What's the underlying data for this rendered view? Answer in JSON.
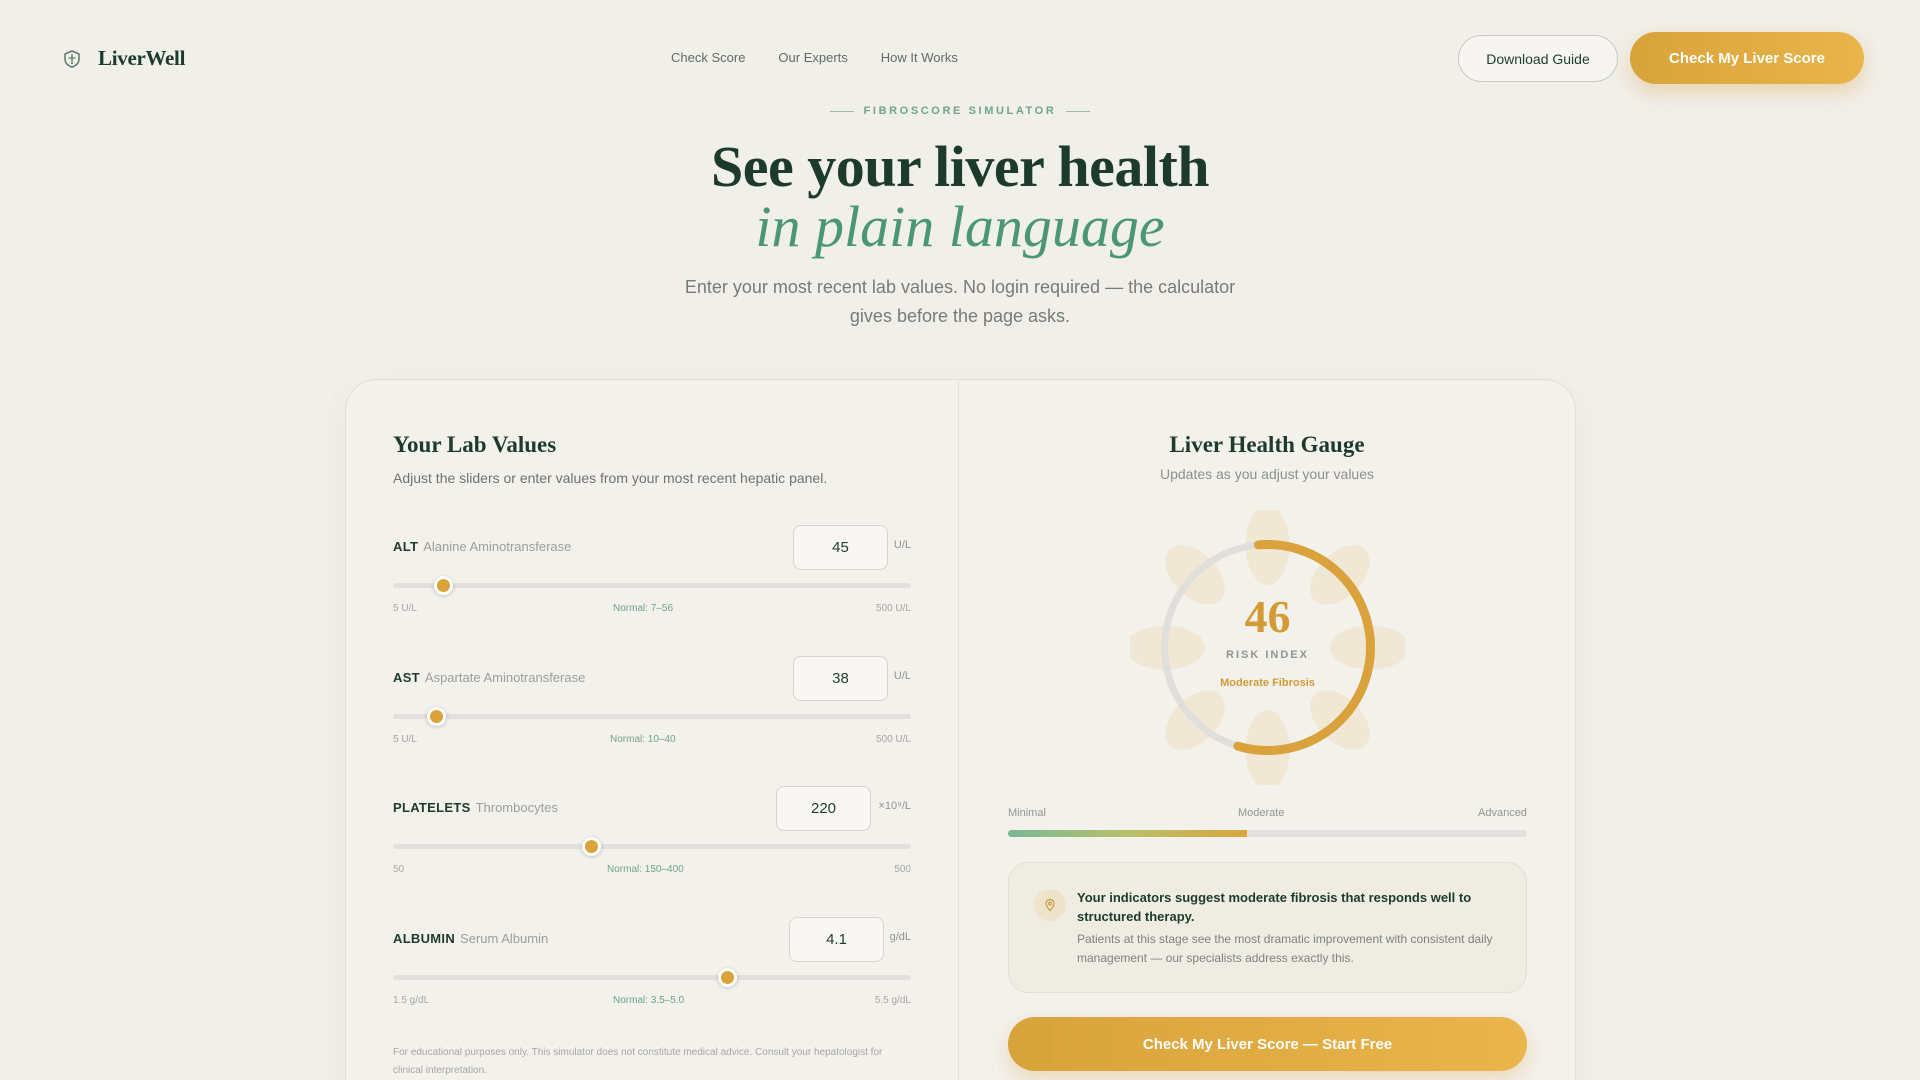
{
  "brand": {
    "name": "LiverWell",
    "icon": "shield-icon"
  },
  "nav": {
    "links": [
      "Check Score",
      "Our Experts",
      "How It Works"
    ],
    "download_label": "Download Guide",
    "cta_label": "Check My Liver Score"
  },
  "hero": {
    "eyebrow": "FIBROSCORE SIMULATOR",
    "title_line1": "See your liver health",
    "title_line2": "in plain language",
    "subtitle": "Enter your most recent lab values. No login required — the calculator gives before the page asks."
  },
  "lab_panel": {
    "title": "Your Lab Values",
    "subtitle": "Adjust the sliders or enter values from your most recent hepatic panel.",
    "labs": [
      {
        "abbr": "ALT",
        "name": "Alanine Aminotransferase",
        "value": "45",
        "unit": "U/L",
        "min_label": "5 U/L",
        "normal_label": "Normal: 7–56",
        "max_label": "500 U/L",
        "slider_fraction": 0.097
      },
      {
        "abbr": "AST",
        "name": "Aspartate Aminotransferase",
        "value": "38",
        "unit": "U/L",
        "min_label": "5 U/L",
        "normal_label": "Normal: 10–40",
        "max_label": "500 U/L",
        "slider_fraction": 0.083
      },
      {
        "abbr": "PLATELETS",
        "name": "Thrombocytes",
        "value": "220",
        "unit": "×10⁹/L",
        "min_label": "50",
        "normal_label": "Normal: 150–400",
        "max_label": "500",
        "slider_fraction": 0.382
      },
      {
        "abbr": "ALBUMIN",
        "name": "Serum Albumin",
        "value": "4.1",
        "unit": "g/dL",
        "min_label": "1.5 g/dL",
        "normal_label": "Normal: 3.5–5.0",
        "max_label": "5.5 g/dL",
        "slider_fraction": 0.644
      }
    ],
    "disclaimer": "For educational purposes only. This simulator does not constitute medical advice. Consult your hepatologist for clinical interpretation."
  },
  "gauge_panel": {
    "title": "Liver Health Gauge",
    "subtitle": "Updates as you adjust your values",
    "score": "46",
    "score_fraction": 0.46,
    "score_label": "RISK INDEX",
    "stage": "Moderate Fibrosis",
    "scale_labels": [
      "Minimal",
      "Moderate",
      "Advanced"
    ],
    "scale_fill_fraction": 0.46,
    "insight_icon": "location-pin-icon",
    "insight_title": "Your indicators suggest moderate fibrosis that responds well to structured therapy.",
    "insight_body": "Patients at this stage see the most dramatic improvement with consistent daily management — our specialists address exactly this.",
    "cta_label": "Check My Liver Score — Start Free"
  },
  "colors": {
    "accent_gold": "#dca33b",
    "brand_green": "#1d3b2c",
    "accent_green": "#4b9673",
    "background": "#f1efea"
  }
}
